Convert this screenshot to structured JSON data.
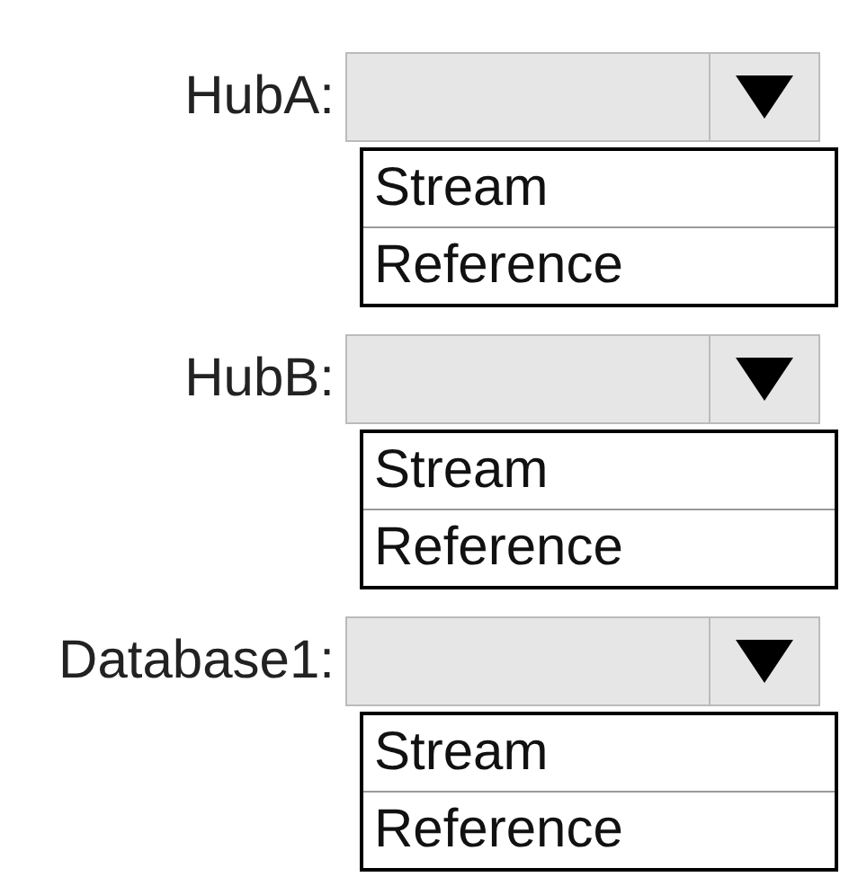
{
  "dropdowns": [
    {
      "label": "HubA:",
      "options": [
        "Stream",
        "Reference"
      ]
    },
    {
      "label": "HubB:",
      "options": [
        "Stream",
        "Reference"
      ]
    },
    {
      "label": "Database1:",
      "options": [
        "Stream",
        "Reference"
      ]
    }
  ]
}
